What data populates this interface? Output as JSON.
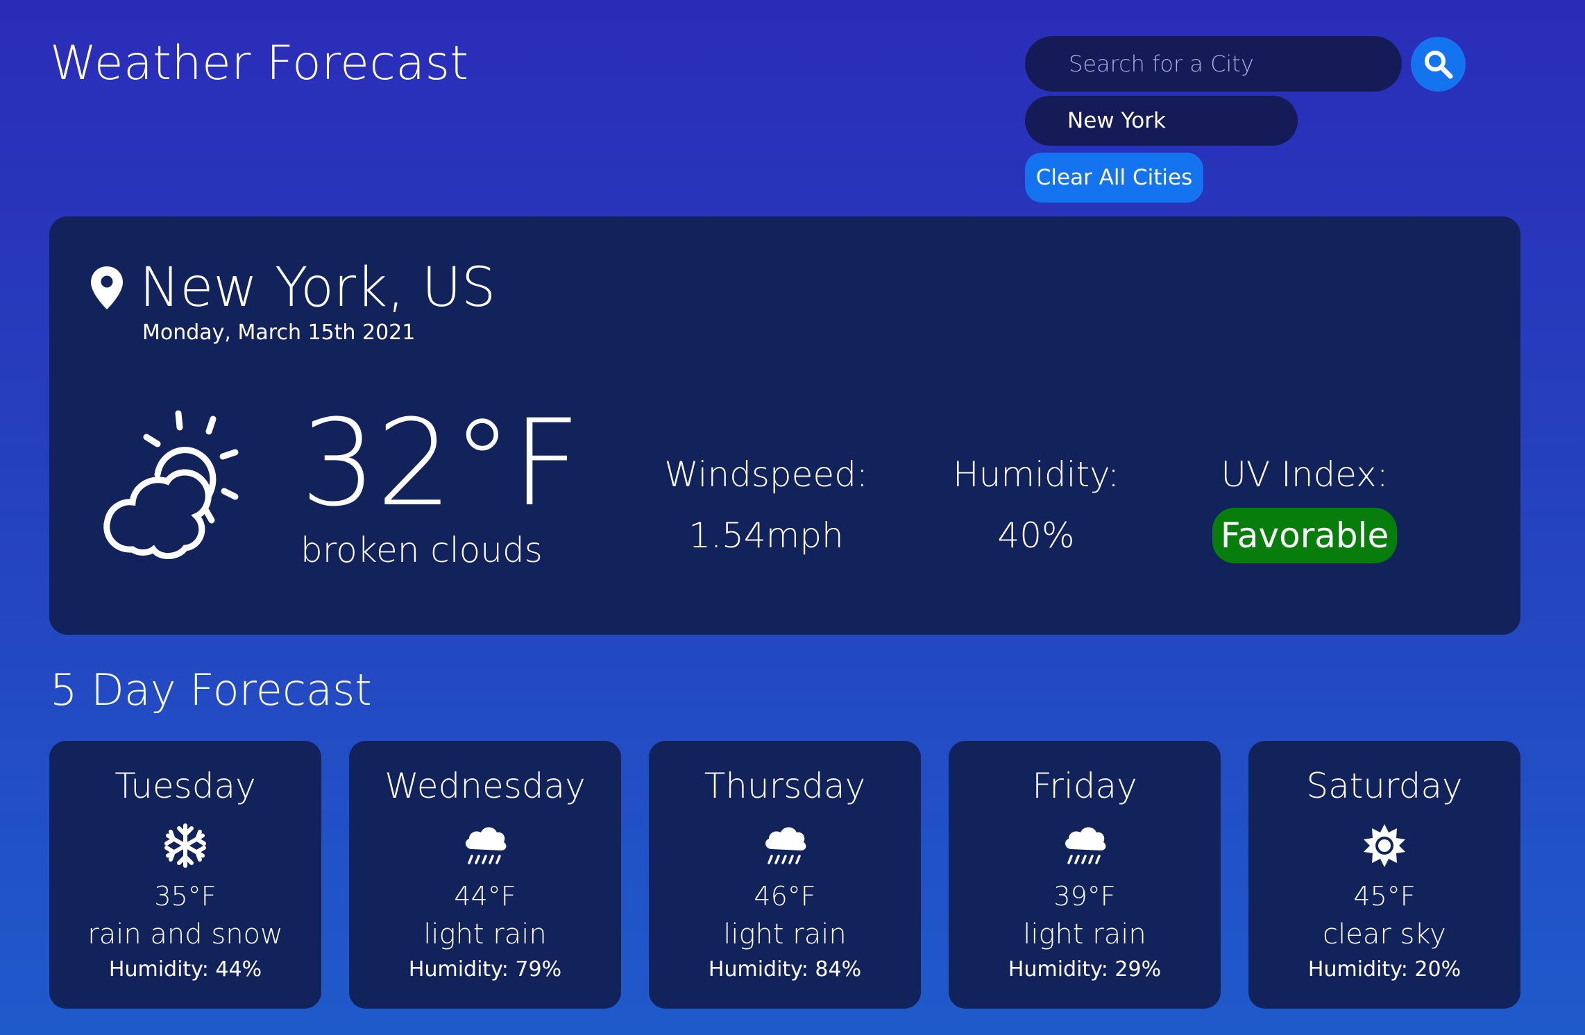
{
  "header": {
    "title": "Weather Forecast"
  },
  "search": {
    "placeholder": "Search for a City",
    "history": [
      "New York"
    ],
    "clear_label": "Clear All Cities"
  },
  "current": {
    "location": "New York, US",
    "date": "Monday, March 15th 2021",
    "icon": "partly-cloudy-icon",
    "temperature": "32°F",
    "description": "broken clouds",
    "windspeed_label": "Windspeed:",
    "windspeed": "1.54mph",
    "humidity_label": "Humidity:",
    "humidity": "40%",
    "uv_label": "UV Index:",
    "uv": "Favorable",
    "uv_color": "#077d0c"
  },
  "forecast": {
    "title": "5 Day Forecast",
    "days": [
      {
        "day": "Tuesday",
        "icon": "snowflake-icon",
        "temp": "35°F",
        "desc": "rain and snow",
        "humidity": "Humidity: 44%"
      },
      {
        "day": "Wednesday",
        "icon": "rain-cloud-icon",
        "temp": "44°F",
        "desc": "light rain",
        "humidity": "Humidity: 79%"
      },
      {
        "day": "Thursday",
        "icon": "rain-cloud-icon",
        "temp": "46°F",
        "desc": "light rain",
        "humidity": "Humidity: 84%"
      },
      {
        "day": "Friday",
        "icon": "rain-cloud-icon",
        "temp": "39°F",
        "desc": "light rain",
        "humidity": "Humidity: 29%"
      },
      {
        "day": "Saturday",
        "icon": "sun-icon",
        "temp": "45°F",
        "desc": "clear sky",
        "humidity": "Humidity: 20%"
      }
    ]
  },
  "colors": {
    "background": "#2a2cb8",
    "card": "#12235c",
    "accent": "#1474ef",
    "input": "#141b57"
  }
}
